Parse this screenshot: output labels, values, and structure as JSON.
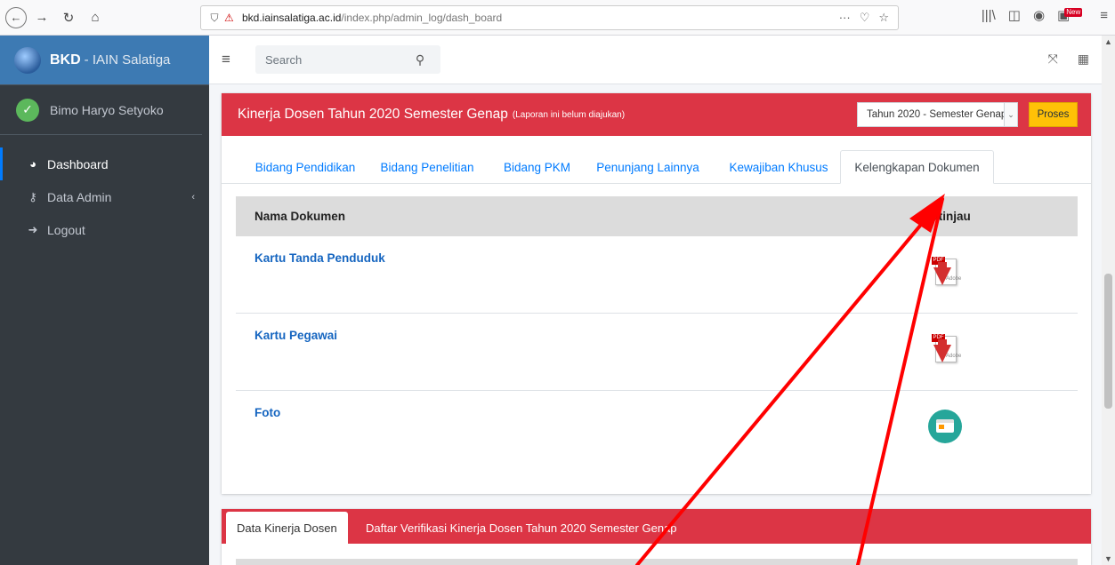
{
  "browser": {
    "url_domain": "bkd.iainsalatiga.ac.id",
    "url_path": "/index.php/admin_log/dash_board",
    "new_badge": "New"
  },
  "sidebar": {
    "brand_strong": "BKD",
    "brand_light": "- IAIN Salatiga",
    "user_name": "Bimo Haryo Setyoko",
    "items": [
      {
        "label": "Dashboard",
        "icon": "tachometer-icon",
        "active": true
      },
      {
        "label": "Data Admin",
        "icon": "key-icon",
        "active": false
      },
      {
        "label": "Logout",
        "icon": "sign-out-icon",
        "active": false
      }
    ]
  },
  "topnav": {
    "search_placeholder": "Search"
  },
  "card": {
    "title": "Kinerja Dosen  Tahun 2020 Semester Genap",
    "note": "(Laporan ini belum diajukan)",
    "select_value": "Tahun 2020 - Semester Genap",
    "proses_label": "Proses",
    "accent": "#dc3545",
    "tabs": [
      {
        "label": "Bidang Pendidikan"
      },
      {
        "label": "Bidang Penelitian"
      },
      {
        "label": "Bidang PKM"
      },
      {
        "label": "Penunjang Lainnya"
      },
      {
        "label": "Kewajiban Khusus"
      },
      {
        "label": "Kelengkapan Dokumen",
        "active": true
      }
    ],
    "table": {
      "col_name": "Nama Dokumen",
      "col_view": "Pratinjau",
      "rows": [
        {
          "name": "Kartu Tanda Penduduk",
          "icon": "pdf-icon"
        },
        {
          "name": "Kartu Pegawai",
          "icon": "pdf-icon"
        },
        {
          "name": "Foto",
          "icon": "image-card-icon"
        }
      ]
    }
  },
  "card2": {
    "tabs": [
      {
        "label": "Data Kinerja Dosen",
        "active": true
      },
      {
        "label": "Daftar Verifikasi Kinerja Dosen Tahun 2020 Semester Genap"
      }
    ]
  },
  "annotation_color": "#ff0000"
}
